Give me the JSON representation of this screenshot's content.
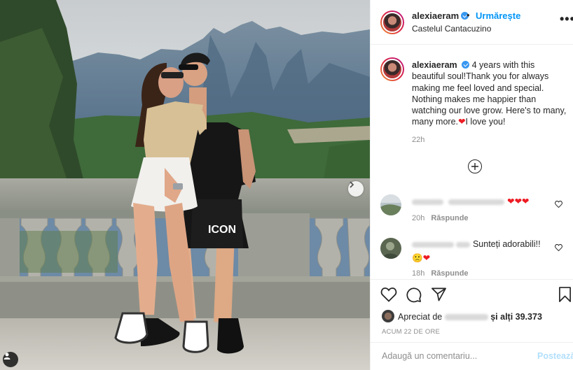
{
  "post": {
    "username": "alexiaeram",
    "follow_label": "Urmărește",
    "separator": "•",
    "location": "Castelul Cantacuzino",
    "more_icon": "more-options-icon"
  },
  "caption": {
    "username": "alexiaeram",
    "text_before_emoji": "4 years with this beautiful soul!Thank you for always making me feel loved and special. Nothing makes me happier than watching our love grow. Here's to many, many more.",
    "emoji": "❤",
    "text_after_emoji": "I love you!",
    "time": "22h"
  },
  "comments": [
    {
      "emojis": "❤❤❤",
      "time": "20h",
      "reply_label": "Răspunde"
    },
    {
      "text": "Sunteți adorabili!!",
      "emojis": "🙁❤",
      "time": "18h",
      "reply_label": "Răspunde"
    }
  ],
  "likes": {
    "prefix": "Apreciat de",
    "user": "fddiglolato",
    "connector": "și",
    "others": "alți 39.373"
  },
  "timestamp": "ACUM 22 DE ORE",
  "add_comment": {
    "placeholder": "Adaugă un comentariu...",
    "post_label": "Postează"
  },
  "colors": {
    "accent": "#0095f6",
    "post_disabled": "#b2dffc",
    "verified": "#3897f0",
    "heart": "#ed1c24"
  }
}
